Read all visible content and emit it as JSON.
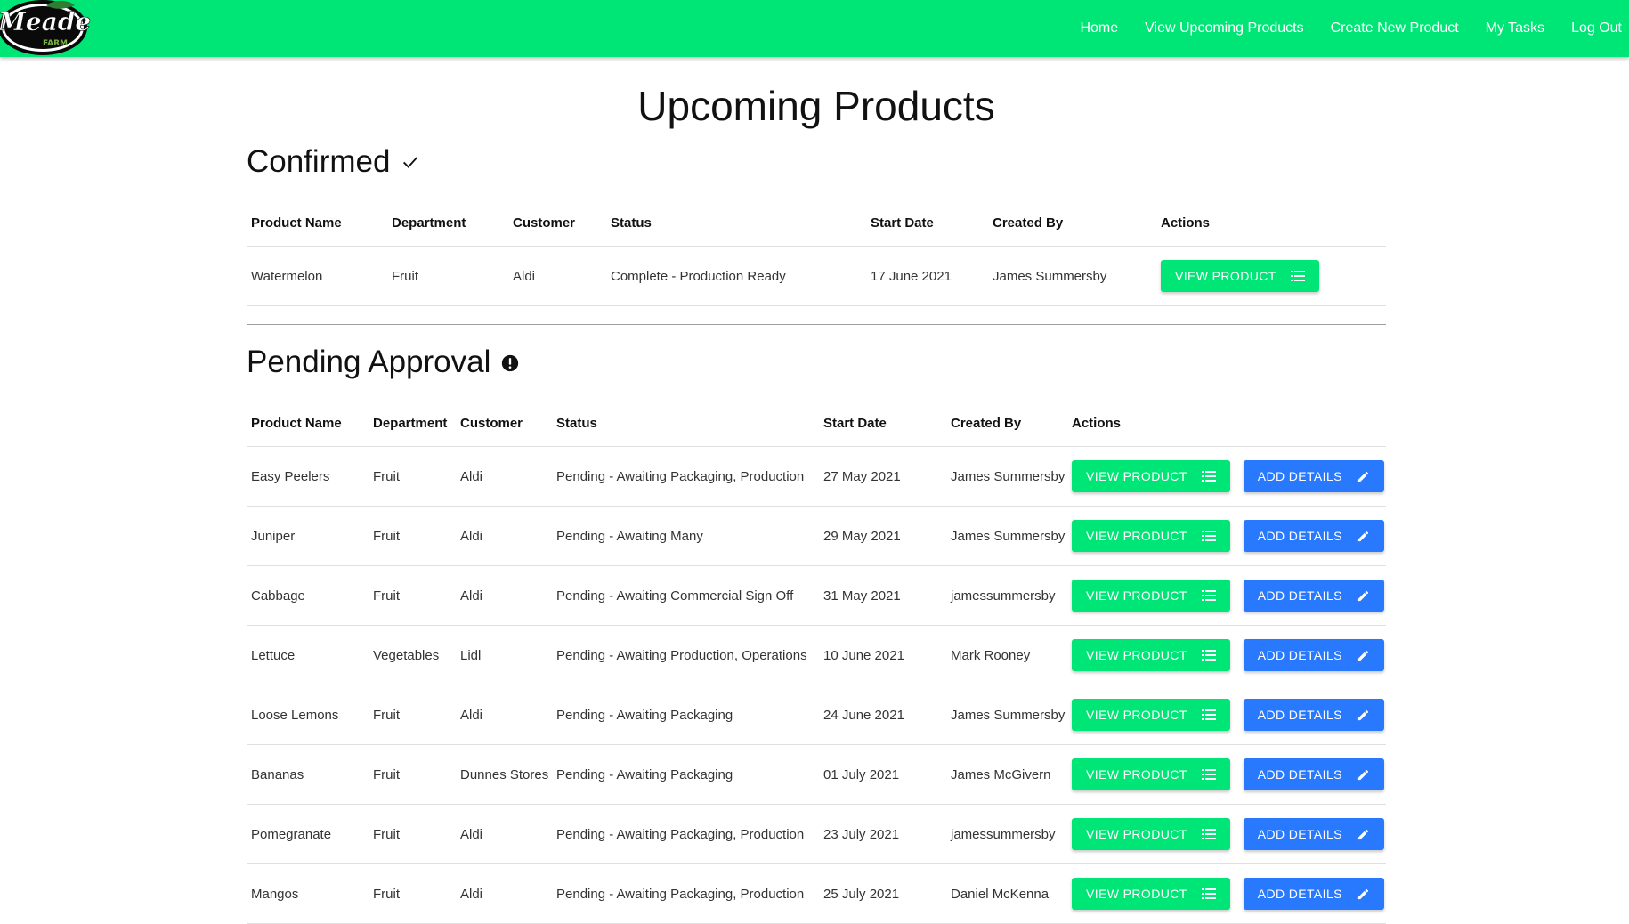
{
  "nav": {
    "logo_text": "Meade",
    "logo_subtext": "FARM",
    "links": [
      "Home",
      "View Upcoming Products",
      "Create New Product",
      "My Tasks",
      "Log Out"
    ]
  },
  "page_title": "Upcoming Products",
  "confirmed": {
    "title": "Confirmed",
    "icon": "check-icon",
    "headers": [
      "Product Name",
      "Department",
      "Customer",
      "Status",
      "Start Date",
      "Created By",
      "Actions"
    ],
    "rows": [
      {
        "name": "Watermelon",
        "department": "Fruit",
        "customer": "Aldi",
        "status": "Complete - Production Ready",
        "start": "17 June 2021",
        "created_by": "James Summersby",
        "view_label": "VIEW PRODUCT"
      }
    ]
  },
  "pending": {
    "title": "Pending Approval",
    "icon": "exclamation-circle-icon",
    "headers": [
      "Product Name",
      "Department",
      "Customer",
      "Status",
      "Start Date",
      "Created By",
      "Actions"
    ],
    "rows": [
      {
        "name": "Easy Peelers",
        "department": "Fruit",
        "customer": "Aldi",
        "status": "Pending - Awaiting Packaging, Production",
        "start": "27 May 2021",
        "created_by": "James Summersby",
        "view_label": "VIEW PRODUCT",
        "add_label": "ADD DETAILS"
      },
      {
        "name": "Juniper",
        "department": "Fruit",
        "customer": "Aldi",
        "status": "Pending - Awaiting Many",
        "start": "29 May 2021",
        "created_by": "James Summersby",
        "view_label": "VIEW PRODUCT",
        "add_label": "ADD DETAILS"
      },
      {
        "name": "Cabbage",
        "department": "Fruit",
        "customer": "Aldi",
        "status": "Pending - Awaiting Commercial Sign Off",
        "start": "31 May 2021",
        "created_by": "jamessummersby",
        "view_label": "VIEW PRODUCT",
        "add_label": "ADD DETAILS"
      },
      {
        "name": "Lettuce",
        "department": "Vegetables",
        "customer": "Lidl",
        "status": "Pending - Awaiting Production, Operations",
        "start": "10 June 2021",
        "created_by": "Mark Rooney",
        "view_label": "VIEW PRODUCT",
        "add_label": "ADD DETAILS"
      },
      {
        "name": "Loose Lemons",
        "department": "Fruit",
        "customer": "Aldi",
        "status": "Pending - Awaiting Packaging",
        "start": "24 June 2021",
        "created_by": "James Summersby",
        "view_label": "VIEW PRODUCT",
        "add_label": "ADD DETAILS"
      },
      {
        "name": "Bananas",
        "department": "Fruit",
        "customer": "Dunnes Stores",
        "status": "Pending - Awaiting Packaging",
        "start": "01 July 2021",
        "created_by": "James McGivern",
        "view_label": "VIEW PRODUCT",
        "add_label": "ADD DETAILS"
      },
      {
        "name": "Pomegranate",
        "department": "Fruit",
        "customer": "Aldi",
        "status": "Pending - Awaiting Packaging, Production",
        "start": "23 July 2021",
        "created_by": "jamessummersby",
        "view_label": "VIEW PRODUCT",
        "add_label": "ADD DETAILS"
      },
      {
        "name": "Mangos",
        "department": "Fruit",
        "customer": "Aldi",
        "status": "Pending - Awaiting Packaging, Production",
        "start": "25 July 2021",
        "created_by": "Daniel McKenna",
        "view_label": "VIEW PRODUCT",
        "add_label": "ADD DETAILS"
      }
    ]
  },
  "colors": {
    "nav_green": "#00e676",
    "button_green": "#00e676",
    "button_blue": "#2979ff"
  }
}
